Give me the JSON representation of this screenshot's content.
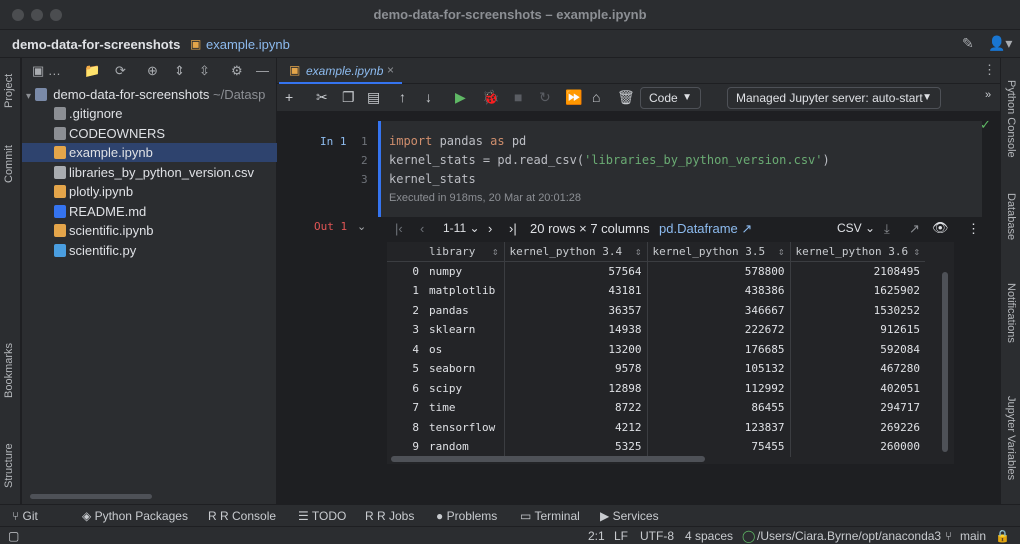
{
  "window": {
    "title": "demo-data-for-screenshots – example.ipynb"
  },
  "navbar": {
    "project": "demo-data-for-screenshots",
    "file": "example.ipynb"
  },
  "left_strip": [
    "Project",
    "Commit",
    "Bookmarks",
    "Structure"
  ],
  "right_strip": [
    "Python Console",
    "Database",
    "Notifications",
    "Jupyter Variables"
  ],
  "project_panel": {
    "root_name": "demo-data-for-screenshots",
    "root_path": "~/Datasp",
    "files": [
      {
        "name": ".gitignore",
        "color": "#8c8f94"
      },
      {
        "name": "CODEOWNERS",
        "color": "#8c8f94"
      },
      {
        "name": "example.ipynb",
        "color": "#e4a54a",
        "selected": true
      },
      {
        "name": "libraries_by_python_version.csv",
        "color": "#a9acb0"
      },
      {
        "name": "plotly.ipynb",
        "color": "#e4a54a"
      },
      {
        "name": "README.md",
        "color": "#3574f0"
      },
      {
        "name": "scientific.ipynb",
        "color": "#e4a54a"
      },
      {
        "name": "scientific.py",
        "color": "#4a9ee0"
      }
    ]
  },
  "editor": {
    "tab": "example.ipynb",
    "cell_type": "Code",
    "server": "Managed Jupyter server: auto-start",
    "cell": {
      "in_label": "In 1",
      "lines": [
        "1",
        "2",
        "3"
      ],
      "exec_info": "Executed in 918ms, 20 Mar at 20:01:28"
    },
    "output": {
      "out_label": "Out 1",
      "range": "1-11",
      "shape": "20 rows × 7 columns",
      "type_link": "pd.Dataframe ↗",
      "format": "CSV",
      "columns": [
        "library",
        "kernel_python 3.4",
        "kernel_python 3.5",
        "kernel_python 3.6"
      ],
      "rows": [
        [
          "0",
          "numpy",
          "57564",
          "578800",
          "2108495"
        ],
        [
          "1",
          "matplotlib",
          "43181",
          "438386",
          "1625902"
        ],
        [
          "2",
          "pandas",
          "36357",
          "346667",
          "1530252"
        ],
        [
          "3",
          "sklearn",
          "14938",
          "222672",
          "912615"
        ],
        [
          "4",
          "os",
          "13200",
          "176685",
          "592084"
        ],
        [
          "5",
          "seaborn",
          "9578",
          "105132",
          "467280"
        ],
        [
          "6",
          "scipy",
          "12898",
          "112992",
          "402051"
        ],
        [
          "7",
          "time",
          "8722",
          "86455",
          "294717"
        ],
        [
          "8",
          "tensorflow",
          "4212",
          "123837",
          "269226"
        ],
        [
          "9",
          "random",
          "5325",
          "75455",
          "260000"
        ]
      ]
    }
  },
  "bottom_tools": [
    "Git",
    "Python Packages",
    "R Console",
    "TODO",
    "R Jobs",
    "Problems",
    "Terminal",
    "Services"
  ],
  "status": {
    "position": "2:1",
    "line_sep": "LF",
    "encoding": "UTF-8",
    "indent": "4 spaces",
    "interpreter": "/Users/Ciara.Byrne/opt/anaconda3",
    "branch": "main"
  }
}
